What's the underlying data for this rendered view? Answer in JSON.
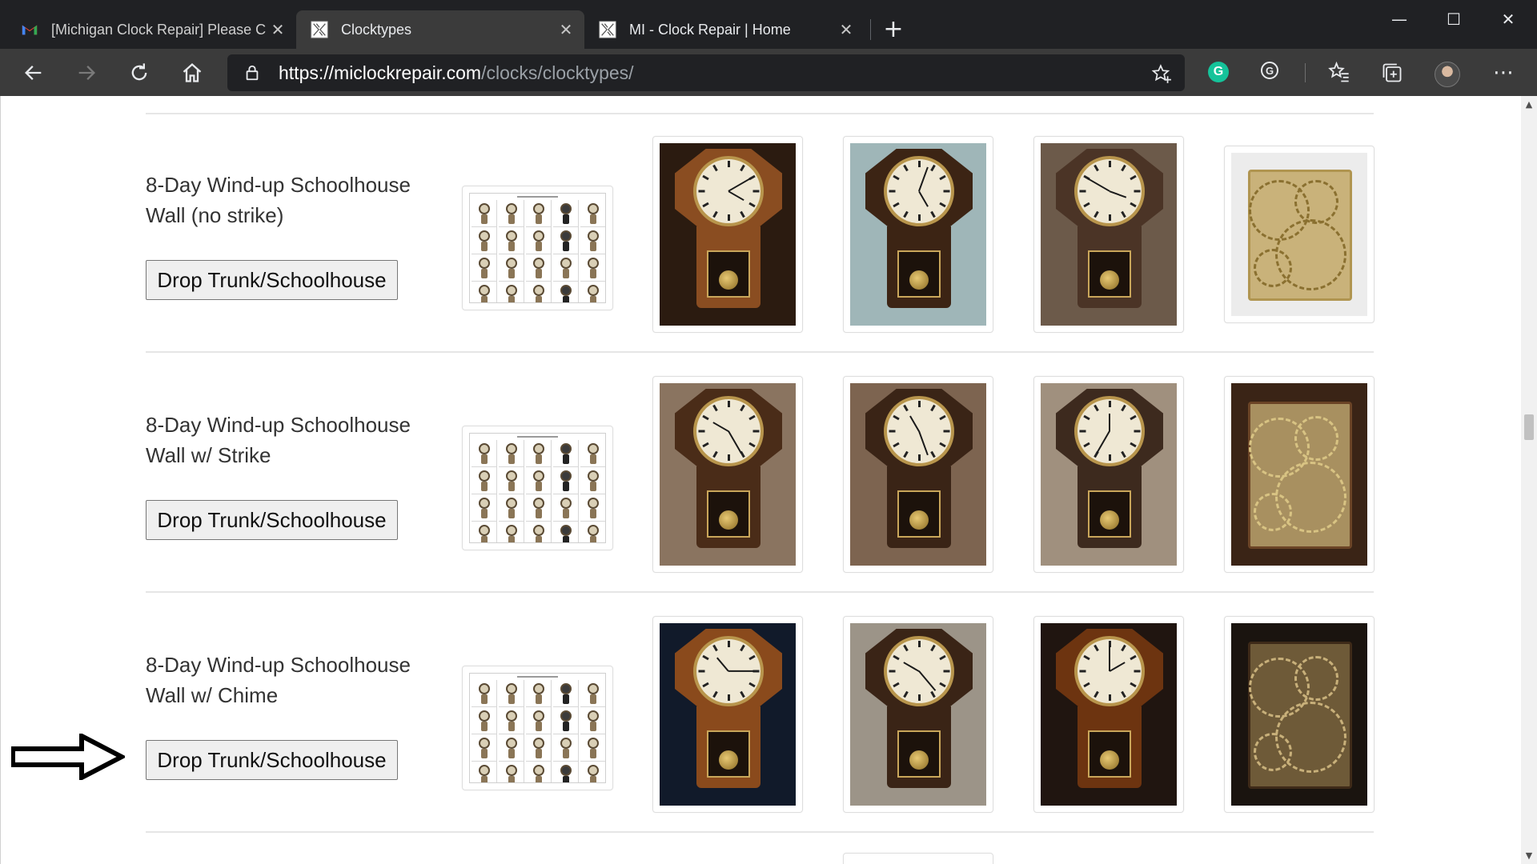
{
  "browser": {
    "tabs": [
      {
        "title": "[Michigan Clock Repair] Please C",
        "icon": "gmail-icon",
        "active": false
      },
      {
        "title": "Clocktypes",
        "icon": "site-icon",
        "active": true
      },
      {
        "title": "MI - Clock Repair | Home",
        "icon": "site-icon",
        "active": false
      }
    ],
    "close_glyph": "✕",
    "new_tab_glyph": "+",
    "window_controls": {
      "minimize": "—",
      "maximize": "☐",
      "close": "✕"
    },
    "url_host": "https://miclockrepair.com",
    "url_path": "/clocks/clocktypes/",
    "toolbar_icons": [
      "back-icon",
      "forward-icon",
      "refresh-icon",
      "home-icon",
      "lock-icon",
      "add-favorite-icon",
      "grammarly-icon",
      "extension-g-icon",
      "favorites-icon",
      "collections-icon",
      "profile-avatar",
      "more-icon"
    ],
    "grammarly_letter": "G",
    "ext_letter": "G",
    "more_glyph": "⋯"
  },
  "page": {
    "rows": [
      {
        "label": "8-Day Wind-up Schoolhouse Wall (no strike)",
        "button": "Drop Trunk/Schoolhouse"
      },
      {
        "label": "8-Day Wind-up Schoolhouse Wall w/ Strike",
        "button": "Drop Trunk/Schoolhouse"
      },
      {
        "label": "8-Day Wind-up Schoolhouse Wall w/ Chime",
        "button": "Drop Trunk/Schoolhouse"
      }
    ]
  },
  "colors": {
    "tabbar_bg": "#202124",
    "toolbar_bg": "#3b3b3b",
    "grammarly_green": "#15c39a",
    "button_bg": "#efefef",
    "wood_dark": "#3a2416",
    "wood_medium": "#6b4426"
  }
}
